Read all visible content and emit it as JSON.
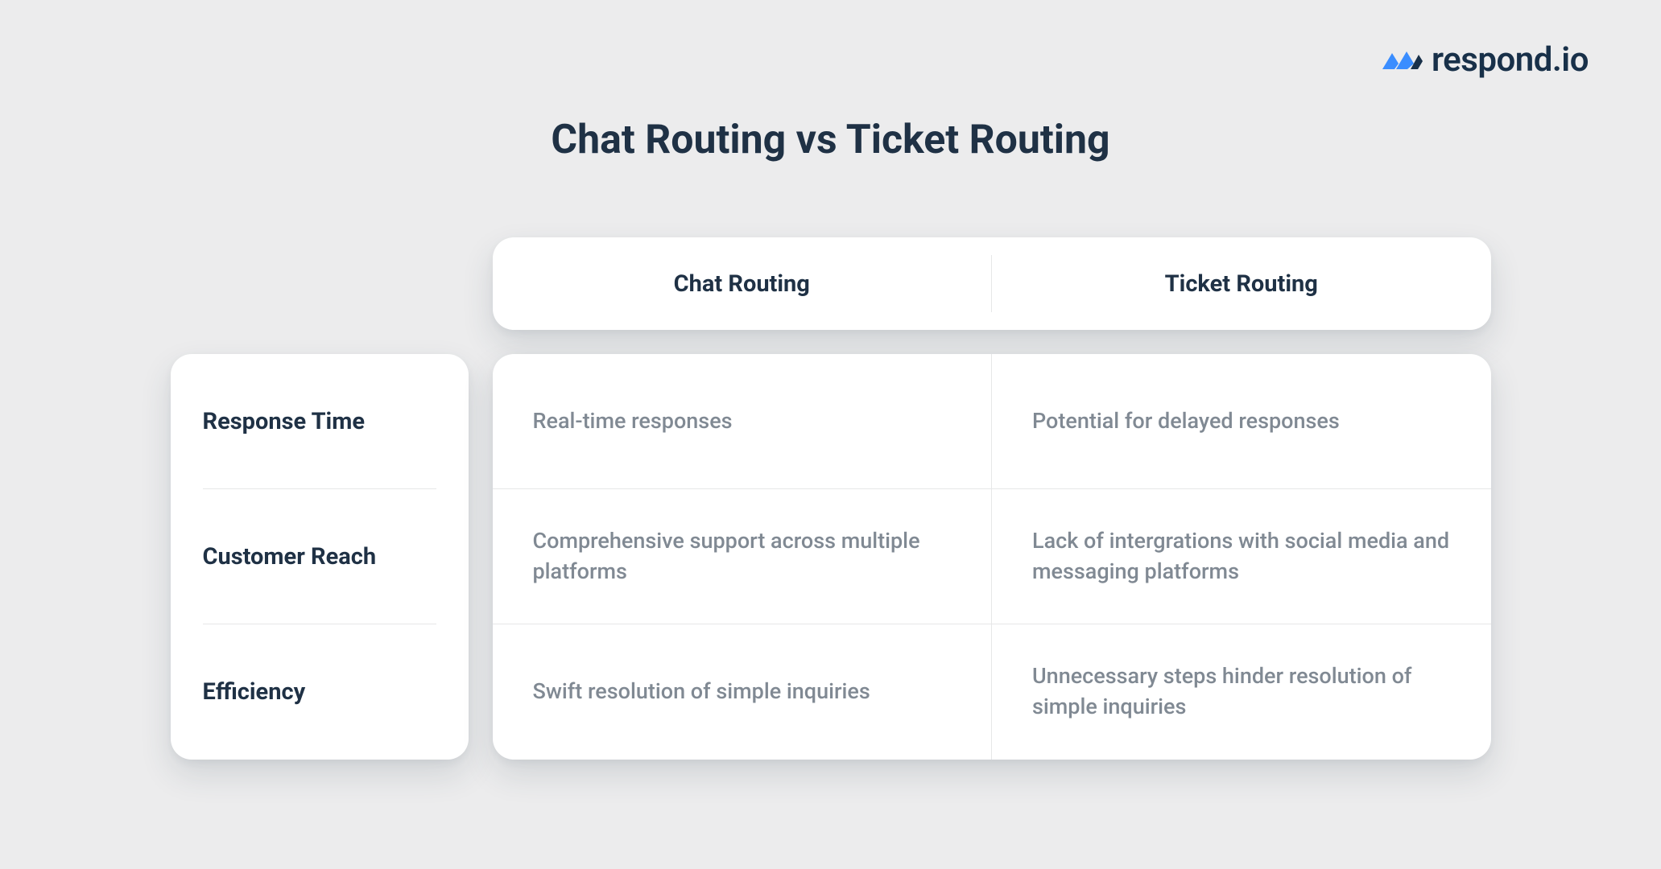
{
  "brand": {
    "name": "respond.io",
    "accent": "#3a8dff"
  },
  "title": "Chat Routing vs Ticket Routing",
  "columns": [
    {
      "label": "Chat Routing"
    },
    {
      "label": "Ticket Routing"
    }
  ],
  "rows": [
    {
      "label": "Response Time",
      "cells": [
        "Real-time responses",
        "Potential for delayed responses"
      ]
    },
    {
      "label": "Customer Reach",
      "cells": [
        "Comprehensive support across multiple platforms",
        "Lack of intergrations with social media and messaging platforms"
      ]
    },
    {
      "label": "Efficiency",
      "cells": [
        "Swift resolution of simple inquiries",
        "Unnecessary steps hinder resolution of simple inquiries"
      ]
    }
  ]
}
